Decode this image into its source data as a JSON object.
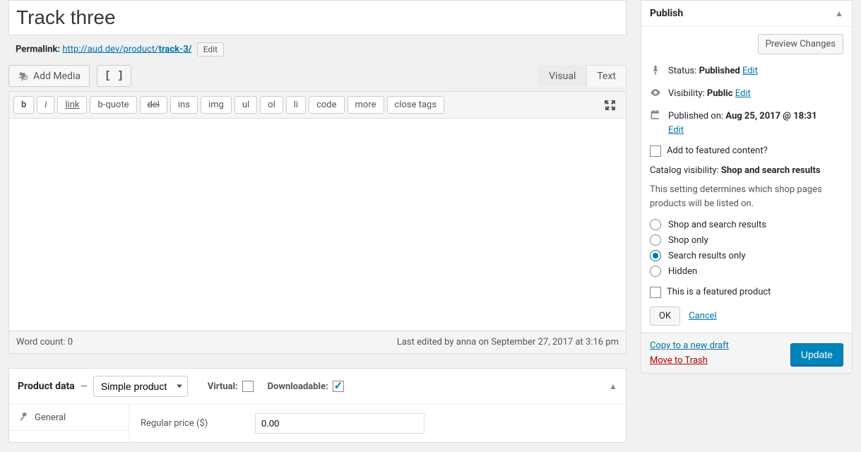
{
  "title": "Track three",
  "permalink": {
    "label": "Permalink:",
    "base": "http://aud.dev/product/",
    "slug": "track-3/",
    "edit_label": "Edit"
  },
  "media": {
    "add_media_label": "Add Media",
    "dfw_label": "[ ]"
  },
  "editor_tabs": {
    "visual": "Visual",
    "text": "Text"
  },
  "toolbar": {
    "b": "b",
    "i": "i",
    "link": "link",
    "bquote": "b-quote",
    "del": "del",
    "ins": "ins",
    "img": "img",
    "ul": "ul",
    "ol": "ol",
    "li": "li",
    "code": "code",
    "more": "more",
    "close": "close tags"
  },
  "status_bar": {
    "word_count_label": "Word count: 0",
    "last_edited": "Last edited by anna on September 27, 2017 at 3:16 pm"
  },
  "product_data": {
    "heading": "Product data",
    "type": "Simple product",
    "virtual_label": "Virtual:",
    "downloadable_label": "Downloadable:",
    "virtual_checked": false,
    "downloadable_checked": true,
    "tab_general": "General",
    "regular_price_label": "Regular price ($)",
    "regular_price_value": "0.00"
  },
  "publish": {
    "title": "Publish",
    "preview_label": "Preview Changes",
    "status_label": "Status:",
    "status_value": "Published",
    "visibility_label": "Visibility:",
    "visibility_value": "Public",
    "published_label": "Published on:",
    "published_value": "Aug 25, 2017 @ 18:31",
    "edit_label": "Edit",
    "featured_content_label": "Add to featured content?",
    "catalog_label": "Catalog visibility:",
    "catalog_value": "Shop and search results",
    "catalog_desc": "This setting determines which shop pages products will be listed on.",
    "radio_options": [
      "Shop and search results",
      "Shop only",
      "Search results only",
      "Hidden"
    ],
    "radio_selected_index": 2,
    "featured_product_label": "This is a featured product",
    "ok_label": "OK",
    "cancel_label": "Cancel",
    "copy_label": "Copy to a new draft",
    "trash_label": "Move to Trash",
    "update_label": "Update"
  }
}
